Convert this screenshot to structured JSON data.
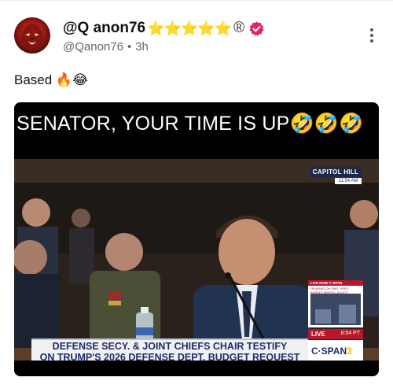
{
  "post": {
    "display_name": "@Q anon76",
    "name_decorations": "⭐⭐⭐⭐⭐",
    "registered_mark": "®",
    "handle": "@Qanon76",
    "separator": "•",
    "time_ago": "3h",
    "text": "Based 🔥😂",
    "verified_color": "#e6245f"
  },
  "media": {
    "caption": "SENATOR, YOUR TIME IS UP🤣🤣🤣",
    "location_badge": "CAPITOL HILL",
    "location_time": "11:54 AM",
    "live_box_header": "LIVE NOW C-SPAN",
    "live_box_subtitle": "HEARING ON FMR. PRES. BIDEN'S MENTAL ACUITY",
    "live_bar_label": "LIVE",
    "live_bar_time": "8:54 PT",
    "headline_line1": "DEFENSE SECY. & JOINT CHIEFS CHAIR TESTIFY",
    "headline_line2": "ON TRUMP'S 2026 DEFENSE DEPT. BUDGET REQUEST",
    "network_prefix": "C·SPAN",
    "network_number": "3"
  },
  "icons": {
    "avatar": "red-lion-avatar",
    "verified": "verified-badge-icon",
    "more": "more-vertical-icon"
  }
}
